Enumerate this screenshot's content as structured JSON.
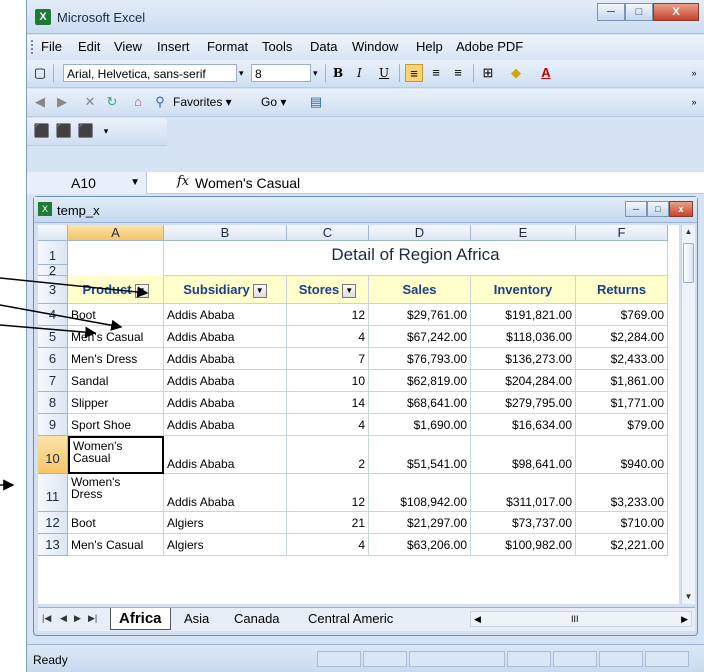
{
  "window": {
    "title": "Microsoft Excel",
    "min": "─",
    "max": "□",
    "close": "X"
  },
  "menu": [
    "File",
    "Edit",
    "View",
    "Insert",
    "Format",
    "Tools",
    "Data",
    "Window",
    "Help",
    "Adobe PDF"
  ],
  "toolbar": {
    "font_name": "Arial, Helvetica, sans-serif",
    "font_size": "8",
    "bold": "B",
    "italic": "I",
    "underline": "U",
    "favorites": "Favorites ▾",
    "go": "Go ▾"
  },
  "formula_bar": {
    "name_box": "A10",
    "fx": "fx",
    "value": "Women's Casual"
  },
  "workbook": {
    "title": "temp_x"
  },
  "columns": [
    "A",
    "B",
    "C",
    "D",
    "E",
    "F"
  ],
  "sheet_title": "Detail of Region Africa",
  "headers": [
    "Product",
    "Subsidiary",
    "Stores",
    "Sales",
    "Inventory",
    "Returns"
  ],
  "rows": [
    {
      "n": "4",
      "product": "Boot",
      "subsidiary": "Addis Ababa",
      "stores": "12",
      "sales": "$29,761.00",
      "inventory": "$191,821.00",
      "returns": "$769.00"
    },
    {
      "n": "5",
      "product": "Men's Casual",
      "subsidiary": "Addis Ababa",
      "stores": "4",
      "sales": "$67,242.00",
      "inventory": "$118,036.00",
      "returns": "$2,284.00"
    },
    {
      "n": "6",
      "product": "Men's Dress",
      "subsidiary": "Addis Ababa",
      "stores": "7",
      "sales": "$76,793.00",
      "inventory": "$136,273.00",
      "returns": "$2,433.00"
    },
    {
      "n": "7",
      "product": "Sandal",
      "subsidiary": "Addis Ababa",
      "stores": "10",
      "sales": "$62,819.00",
      "inventory": "$204,284.00",
      "returns": "$1,861.00"
    },
    {
      "n": "8",
      "product": "Slipper",
      "subsidiary": "Addis Ababa",
      "stores": "14",
      "sales": "$68,641.00",
      "inventory": "$279,795.00",
      "returns": "$1,771.00"
    },
    {
      "n": "9",
      "product": "Sport Shoe",
      "subsidiary": "Addis Ababa",
      "stores": "4",
      "sales": "$1,690.00",
      "inventory": "$16,634.00",
      "returns": "$79.00"
    },
    {
      "n": "10",
      "product1": "Women's",
      "product2": "Casual",
      "subsidiary": "Addis Ababa",
      "stores": "2",
      "sales": "$51,541.00",
      "inventory": "$98,641.00",
      "returns": "$940.00"
    },
    {
      "n": "11",
      "product1": "Women's",
      "product2": "Dress",
      "subsidiary": "Addis Ababa",
      "stores": "12",
      "sales": "$108,942.00",
      "inventory": "$311,017.00",
      "returns": "$3,233.00"
    },
    {
      "n": "12",
      "product": "Boot",
      "subsidiary": "Algiers",
      "stores": "21",
      "sales": "$21,297.00",
      "inventory": "$73,737.00",
      "returns": "$710.00"
    },
    {
      "n": "13",
      "product": "Men's Casual",
      "subsidiary": "Algiers",
      "stores": "4",
      "sales": "$63,206.00",
      "inventory": "$100,982.00",
      "returns": "$2,221.00"
    }
  ],
  "row_labels": {
    "r1": "1",
    "r2": "2",
    "r3": "3"
  },
  "tabs": [
    "Africa",
    "Asia",
    "Canada",
    "Central Americ"
  ],
  "scroll_mark": "III",
  "status": "Ready",
  "colors": {
    "header_fill": "#ffffcc",
    "header_text": "#1a3e8c",
    "selected": "#f5c56a"
  }
}
